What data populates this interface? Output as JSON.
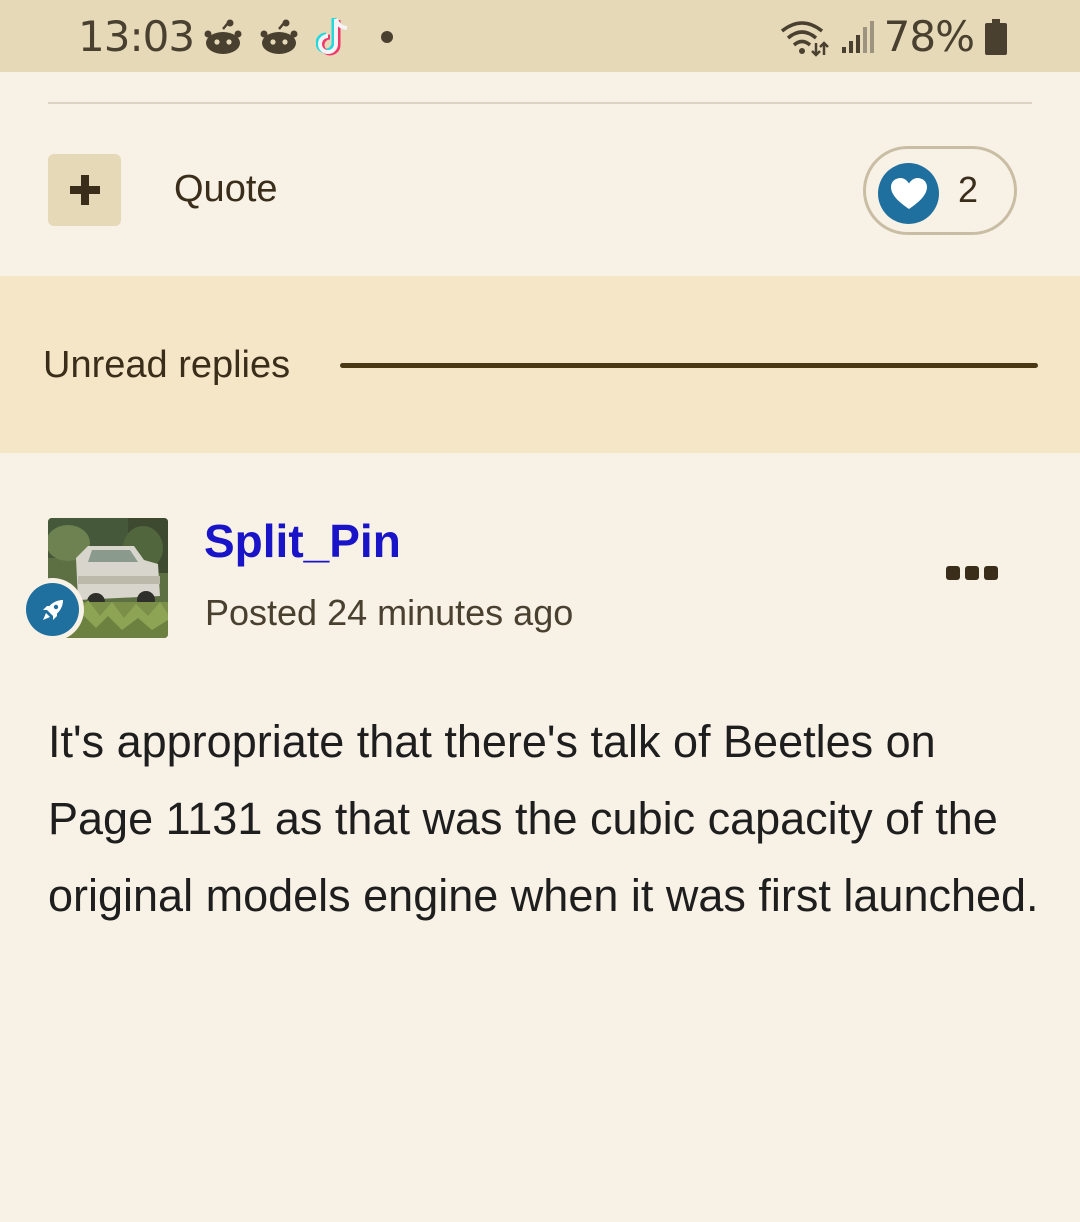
{
  "status_bar": {
    "time": "13:03",
    "battery": "78%",
    "notification_icons": [
      "reddit-icon",
      "reddit-icon",
      "tiktok-icon",
      "dot-icon"
    ],
    "system_icons": [
      "wifi-icon",
      "signal-icon",
      "battery-icon"
    ]
  },
  "actions": {
    "add_icon": "plus-icon",
    "quote_label": "Quote",
    "reaction_icon": "heart-icon",
    "reaction_count": "2"
  },
  "unread": {
    "label": "Unread replies"
  },
  "post": {
    "author": "Split_Pin",
    "posted": "Posted 24 minutes ago",
    "rank_icon": "rocket-icon",
    "menu_icon": "more-options-icon",
    "body": "It's appropriate that there's talk of Beetles on Page 1131 as that was the cubic capacity of the original models engine when it was first launched."
  },
  "colors": {
    "status_bar_bg": "#e6d9b8",
    "page_bg": "#f7f1e6",
    "unread_band_bg": "#f5e6c8",
    "author_link": "#1a14c8",
    "badge_blue": "#1f6f9f"
  }
}
